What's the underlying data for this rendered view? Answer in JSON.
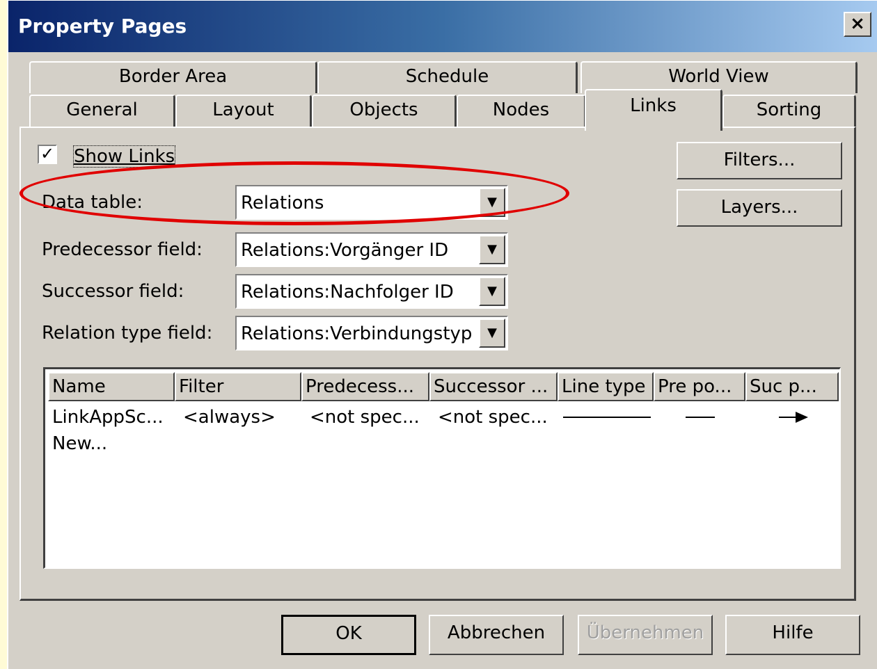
{
  "window": {
    "title": "Property Pages",
    "close_label": "×"
  },
  "tabs": {
    "row1": [
      "Border Area",
      "Schedule",
      "World View"
    ],
    "row2": [
      "General",
      "Layout",
      "Objects",
      "Nodes",
      "Links",
      "Sorting"
    ],
    "active": "Links"
  },
  "links_page": {
    "show_links": {
      "label": "Show Links",
      "checked": true
    },
    "data_table": {
      "label": "Data table:",
      "value": "Relations"
    },
    "predecessor_field": {
      "label": "Predecessor field:",
      "value": "Relations:Vorgänger ID"
    },
    "successor_field": {
      "label": "Successor field:",
      "value": "Relations:Nachfolger ID"
    },
    "relation_type_field": {
      "label": "Relation type field:",
      "value": "Relations:Verbindungstyp"
    },
    "filters_button": "Filters...",
    "layers_button": "Layers...",
    "table": {
      "columns": [
        "Name",
        "Filter",
        "Predecess...",
        "Successor ...",
        "Line type",
        "Pre po...",
        "Suc p..."
      ],
      "rows": [
        {
          "name": "LinkAppSc...",
          "filter": "<always>",
          "predecessor": "<not spec...",
          "successor": "<not spec..."
        },
        {
          "name": "New..."
        }
      ]
    }
  },
  "footer": {
    "ok": "OK",
    "cancel": "Abbrechen",
    "apply": "Übernehmen",
    "help": "Hilfe"
  },
  "annotation": {
    "color": "#e00000"
  },
  "colors": {
    "dialog_bg": "#d4d0c8",
    "page_bg": "#fffbd6",
    "title_start": "#0a246a",
    "title_end": "#a6caf0"
  }
}
